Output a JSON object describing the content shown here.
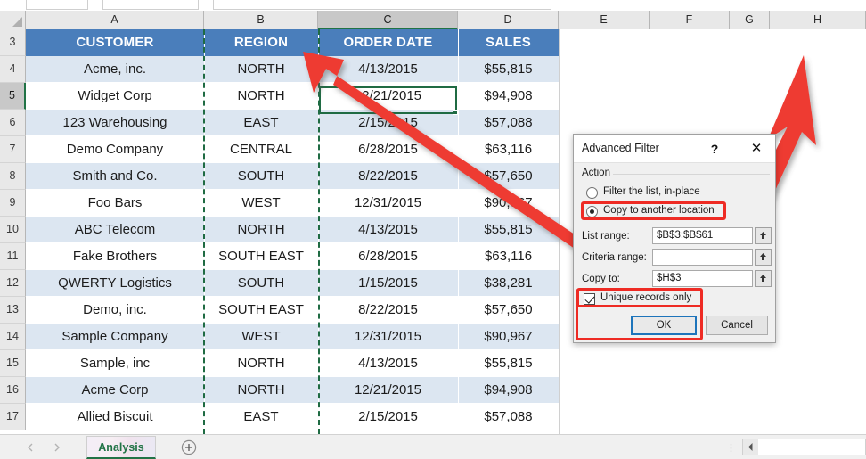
{
  "spreadsheet": {
    "column_headers": [
      "A",
      "B",
      "C",
      "D",
      "E",
      "F",
      "G",
      "H"
    ],
    "active_column": "C",
    "active_row": "5",
    "row_numbers": [
      "3",
      "4",
      "5",
      "6",
      "7",
      "8",
      "9",
      "10",
      "11",
      "12",
      "13",
      "14",
      "15",
      "16",
      "17"
    ],
    "table_headers": [
      "CUSTOMER",
      "REGION",
      "ORDER DATE",
      "SALES"
    ],
    "rows": [
      {
        "row": "4",
        "customer": "Acme, inc.",
        "region": "NORTH",
        "order_date": "4/13/2015",
        "sales": "$55,815"
      },
      {
        "row": "5",
        "customer": "Widget Corp",
        "region": "NORTH",
        "order_date": "12/21/2015",
        "sales": "$94,908"
      },
      {
        "row": "6",
        "customer": "123 Warehousing",
        "region": "EAST",
        "order_date": "2/15/2015",
        "sales": "$57,088"
      },
      {
        "row": "7",
        "customer": "Demo Company",
        "region": "CENTRAL",
        "order_date": "6/28/2015",
        "sales": "$63,116"
      },
      {
        "row": "8",
        "customer": "Smith and Co.",
        "region": "SOUTH",
        "order_date": "8/22/2015",
        "sales": "$57,650"
      },
      {
        "row": "9",
        "customer": "Foo Bars",
        "region": "WEST",
        "order_date": "12/31/2015",
        "sales": "$90,967"
      },
      {
        "row": "10",
        "customer": "ABC Telecom",
        "region": "NORTH",
        "order_date": "4/13/2015",
        "sales": "$55,815"
      },
      {
        "row": "11",
        "customer": "Fake Brothers",
        "region": "SOUTH EAST",
        "order_date": "6/28/2015",
        "sales": "$63,116"
      },
      {
        "row": "12",
        "customer": "QWERTY Logistics",
        "region": "SOUTH",
        "order_date": "1/15/2015",
        "sales": "$38,281"
      },
      {
        "row": "13",
        "customer": "Demo, inc.",
        "region": "SOUTH EAST",
        "order_date": "8/22/2015",
        "sales": "$57,650"
      },
      {
        "row": "14",
        "customer": "Sample Company",
        "region": "WEST",
        "order_date": "12/31/2015",
        "sales": "$90,967"
      },
      {
        "row": "15",
        "customer": "Sample, inc",
        "region": "NORTH",
        "order_date": "4/13/2015",
        "sales": "$55,815"
      },
      {
        "row": "16",
        "customer": "Acme Corp",
        "region": "NORTH",
        "order_date": "12/21/2015",
        "sales": "$94,908"
      },
      {
        "row": "17",
        "customer": "Allied Biscuit",
        "region": "EAST",
        "order_date": "2/15/2015",
        "sales": "$57,088"
      }
    ],
    "colors": {
      "header_fill": "#4a7ebb",
      "band_fill": "#dce6f1",
      "marching_ants": "#1f6b43",
      "active_cell_border": "#1f6b43"
    }
  },
  "dialog": {
    "title": "Advanced Filter",
    "help_label": "?",
    "close_label": "✕",
    "action_group_label": "Action",
    "radio_filter_in_place": "Filter the list, in-place",
    "radio_copy_to_another": "Copy to another location",
    "selected_action": "Copy to another location",
    "list_range_label": "List range:",
    "list_range_value": "$B$3:$B$61",
    "criteria_range_label": "Criteria range:",
    "criteria_range_value": "",
    "copy_to_label": "Copy to:",
    "copy_to_value": "$H$3",
    "unique_records_label": "Unique records only",
    "unique_records_checked": true,
    "ok_label": "OK",
    "cancel_label": "Cancel",
    "picker_icon": "range-picker-up-arrow-icon",
    "highlight_color": "#ee2b24"
  },
  "tabbar": {
    "prev_sheet_icon": "chevron-left-icon",
    "next_sheet_icon": "chevron-right-icon",
    "sheet_name": "Analysis",
    "add_sheet_icon": "plus-circle-icon",
    "overflow_icon": "vertical-dots-icon",
    "scroll_left_icon": "scroll-left-arrow-icon"
  },
  "annotations": {
    "arrow_color": "#ee3a31",
    "arrow_1_name": "arrow-to-region-column",
    "arrow_2_name": "arrow-to-column-h"
  }
}
